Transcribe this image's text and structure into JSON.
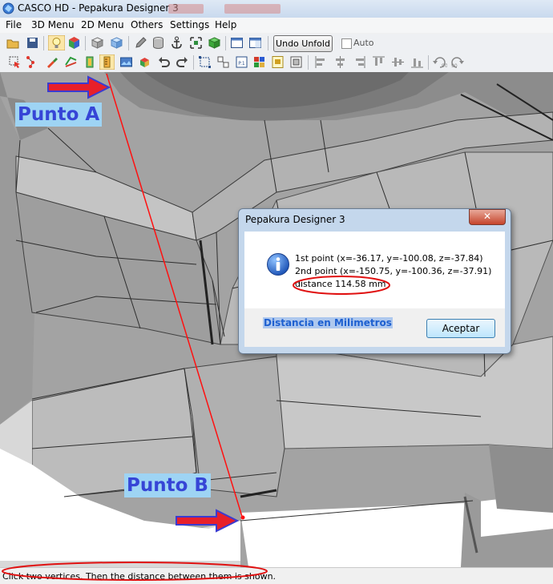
{
  "window": {
    "title": "CASCO HD - Pepakura Designer 3"
  },
  "menubar": {
    "items": [
      "File",
      "3D Menu",
      "2D Menu",
      "Others",
      "Settings",
      "Help"
    ]
  },
  "toolbar": {
    "undo_label": "Undo Unfold",
    "auto_label": "Auto",
    "icons_row1": [
      "open-icon",
      "save-icon",
      "bulb-icon",
      "cube-color-icon",
      "box-icon",
      "box-blue-icon",
      "pencil-icon",
      "cylinder-icon",
      "anchor-icon",
      "fit-icon",
      "layout-single-icon",
      "layout-split-icon"
    ],
    "icons_row2": [
      "select-icon",
      "edge-select-icon",
      "brush-icon",
      "join-icon",
      "measure-icon",
      "image-icon",
      "rotate-part-icon",
      "undo-icon",
      "redo-icon",
      "move-icon",
      "arrange-icon",
      "print-icon",
      "layers-icon",
      "page-icon",
      "frame-icon",
      "align-left-icon",
      "align-center-icon",
      "align-right-icon",
      "align-top-icon",
      "align-middle-icon",
      "align-bottom-icon",
      "rotate-90-left-icon",
      "rotate-90-right-icon"
    ]
  },
  "annotations": {
    "point_a": "Punto A",
    "point_b": "Punto B",
    "accent": "#ff0000"
  },
  "dialog": {
    "title": "Pepakura Designer 3",
    "close": "✕",
    "line1": "1st point (x=-36.17, y=-100.08, z=-37.84)",
    "line2": "2nd point (x=-150.75, y=-100.36, z=-37.91)",
    "line3": "distance 114.58 mm",
    "note": "Distancia en Milimetros",
    "ok": "Aceptar"
  },
  "status": {
    "text": "Click two vertices. Then the distance between them is shown."
  }
}
